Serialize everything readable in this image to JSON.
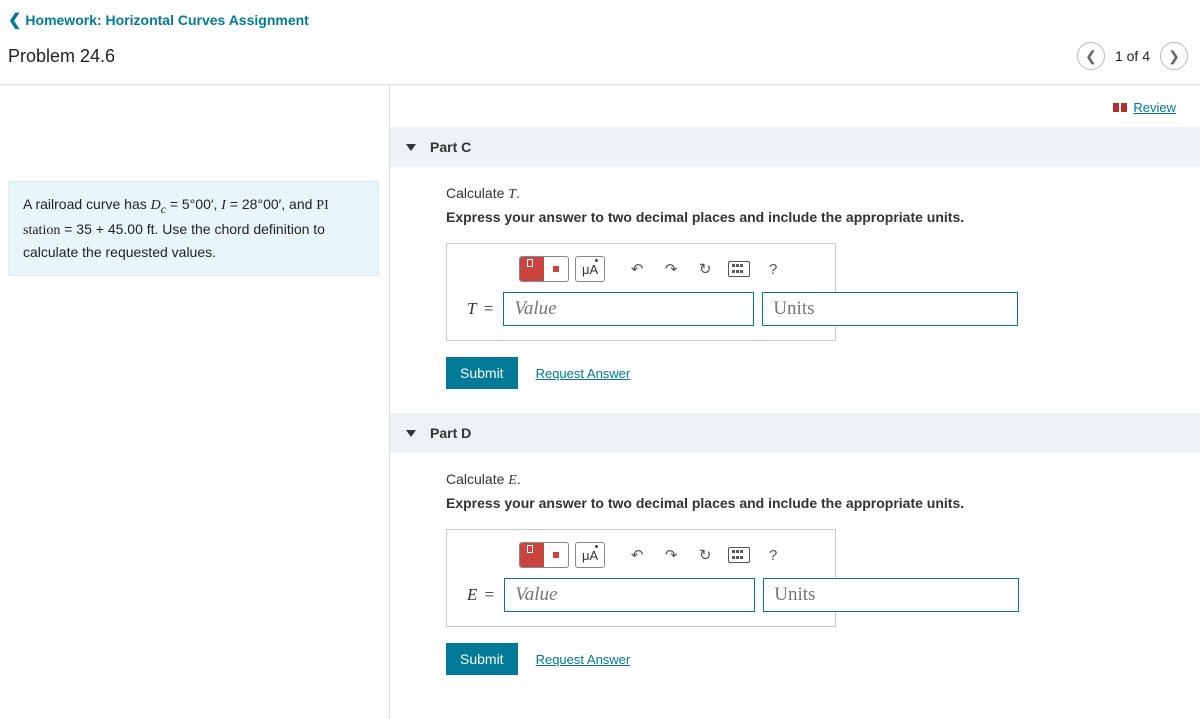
{
  "breadcrumb": {
    "label": "Homework: Horizontal Curves Assignment"
  },
  "problem": {
    "title": "Problem 24.6"
  },
  "nav": {
    "count": "1 of 4"
  },
  "review": {
    "label": " Review"
  },
  "description": {
    "html": "A railroad curve has <span class='math'>D<sub>c</sub></span> = 5°00′, <span class='math'>I</span> = 28°00′, and <span class='math'>PI station</span> = 35 + 45.00 ft. Use the chord definition to calculate the requested values."
  },
  "parts": [
    {
      "header": "Part C",
      "calc_label": "Calculate ",
      "calc_var": "T",
      "calc_punct": ".",
      "sub": "Express your answer to two decimal places and include the appropriate units.",
      "var_label": "T",
      "eq": " =",
      "value_ph": "Value",
      "units_ph": "Units",
      "submit": "Submit",
      "request": "Request Answer",
      "mu": "μA",
      "q": "?"
    },
    {
      "header": "Part D",
      "calc_label": "Calculate ",
      "calc_var": "E",
      "calc_punct": ".",
      "sub": "Express your answer to two decimal places and include the appropriate units.",
      "var_label": "E",
      "eq": " =",
      "value_ph": "Value",
      "units_ph": "Units",
      "submit": "Submit",
      "request": "Request Answer",
      "mu": "μA",
      "q": "?"
    }
  ]
}
